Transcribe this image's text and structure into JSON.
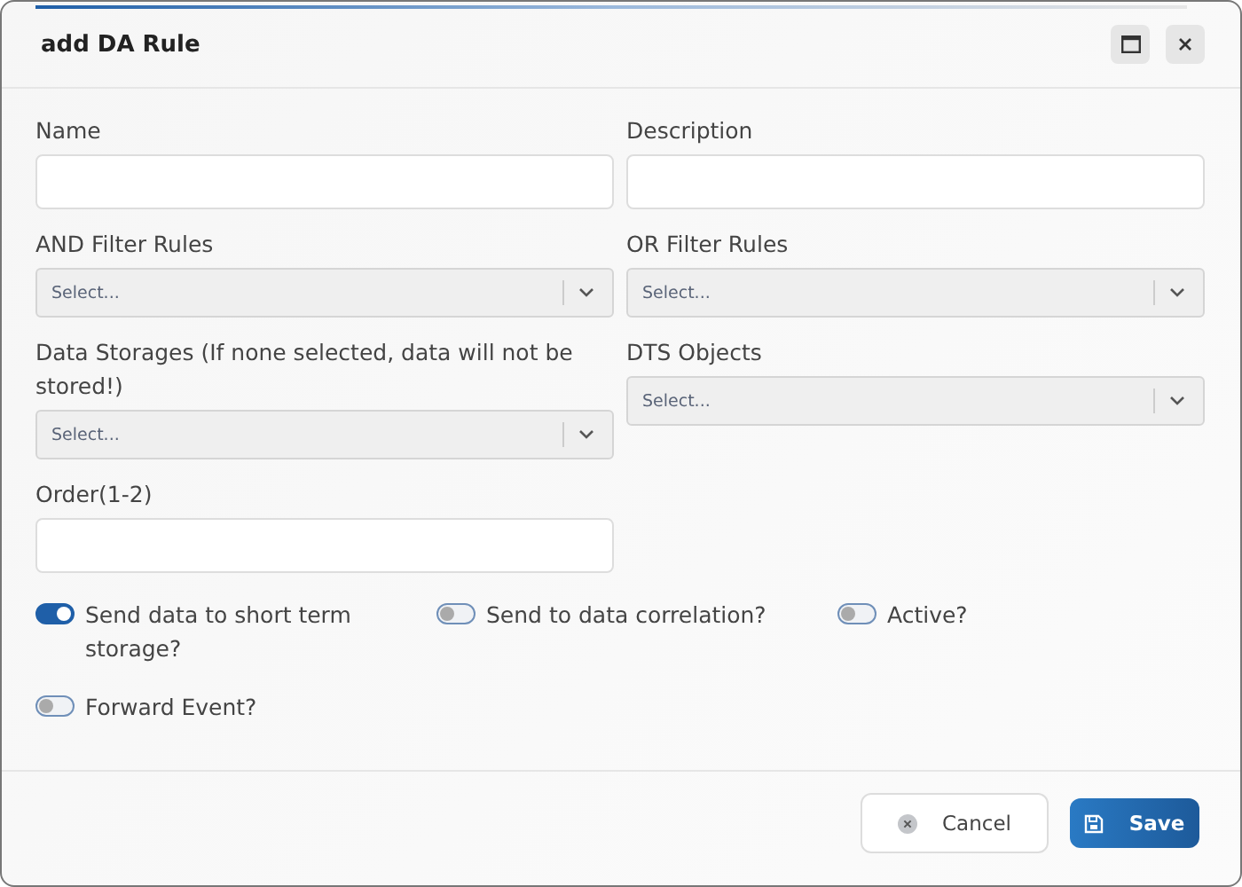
{
  "window": {
    "title": "add DA Rule"
  },
  "fields": [
    {
      "label": "Name",
      "kind": "text"
    },
    {
      "label": "Description",
      "kind": "text"
    },
    {
      "label": "AND Filter Rules",
      "kind": "select",
      "placeholder": "Select..."
    },
    {
      "label": "OR Filter Rules",
      "kind": "select",
      "placeholder": "Select..."
    },
    {
      "label": "Data Storages (If none selected, data will not be stored!)",
      "kind": "select",
      "placeholder": "Select..."
    },
    {
      "label": "DTS Objects",
      "kind": "select",
      "placeholder": "Select..."
    },
    {
      "label": "Order(1-2)",
      "kind": "text"
    }
  ],
  "toggles": [
    {
      "label": "Send data to short term storage?",
      "on": true
    },
    {
      "label": "Send to data correlation?",
      "on": false
    },
    {
      "label": "Active?",
      "on": false
    },
    {
      "label": "Forward Event?",
      "on": false
    }
  ],
  "buttons": [
    {
      "label": "Cancel",
      "kind": "cancel"
    },
    {
      "label": "Save",
      "kind": "save"
    }
  ]
}
